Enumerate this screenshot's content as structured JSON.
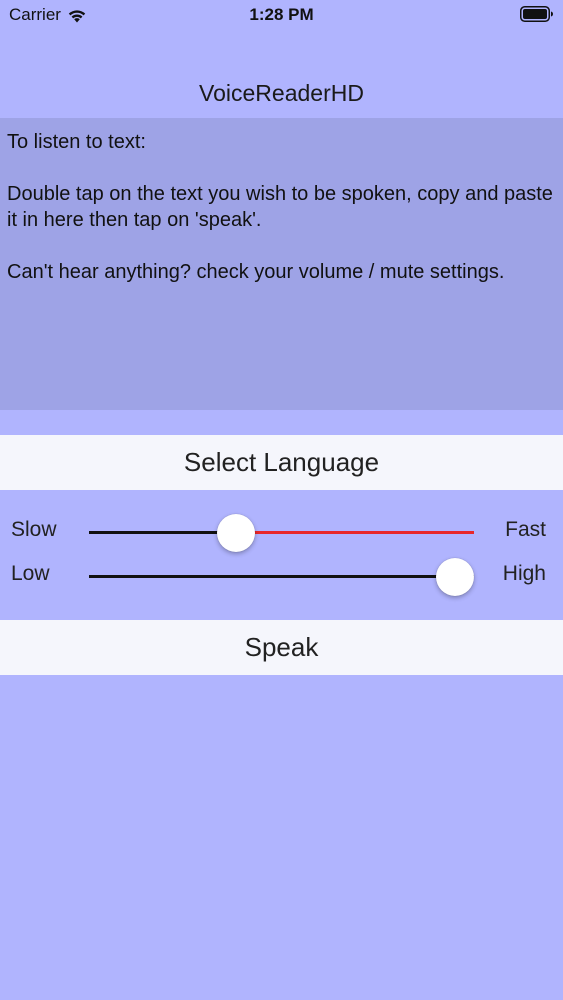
{
  "status_bar": {
    "carrier": "Carrier",
    "time": "1:28 PM",
    "wifi_icon": "wifi-icon",
    "battery_icon": "battery-icon"
  },
  "app": {
    "title": "VoiceReaderHD"
  },
  "text_area": {
    "paragraphs": [
      "To listen to text:",
      "Double tap on the text you wish to be spoken, copy and paste it in here then tap on 'speak'.",
      "Can't hear anything? check your volume / mute settings."
    ]
  },
  "language_button": {
    "label": "Select Language"
  },
  "speed_slider": {
    "min_label": "Slow",
    "max_label": "Fast",
    "value": 0.37,
    "filled_color": "#111111",
    "remaining_color": "#e8272a"
  },
  "pitch_slider": {
    "min_label": "Low",
    "max_label": "High",
    "value": 1.0,
    "filled_color": "#111111",
    "remaining_color": "#e8272a"
  },
  "speak_button": {
    "label": "Speak"
  },
  "colors": {
    "background": "#b0b4fe",
    "text_area_background": "#9ea3e6",
    "button_background": "#f5f6fc"
  }
}
